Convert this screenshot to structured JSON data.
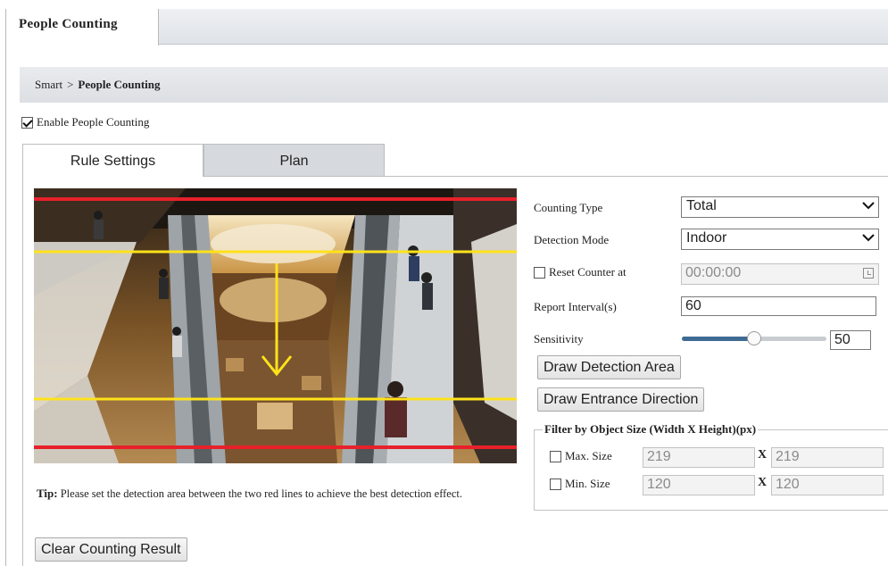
{
  "window_tab": {
    "title": "People Counting"
  },
  "breadcrumb": {
    "parent": "Smart",
    "separator": ">",
    "current": "People Counting"
  },
  "enable": {
    "label": "Enable People Counting",
    "checked": true
  },
  "tabs": [
    {
      "label": "Rule Settings",
      "active": true
    },
    {
      "label": "Plan",
      "active": false
    }
  ],
  "tip": {
    "prefix": "Tip:",
    "text": "Please set the detection area between the two red lines to achieve the best detection effect."
  },
  "buttons": {
    "clear": "Clear Counting Result",
    "draw_area": "Draw Detection Area",
    "draw_direction": "Draw Entrance Direction"
  },
  "settings": {
    "counting_type": {
      "label": "Counting Type",
      "value": "Total"
    },
    "detection_mode": {
      "label": "Detection Mode",
      "value": "Indoor"
    },
    "reset_counter": {
      "label": "Reset Counter at",
      "checked": false,
      "value": "00:00:00"
    },
    "report_interval": {
      "label": "Report Interval(s)",
      "value": "60"
    },
    "sensitivity": {
      "label": "Sensitivity",
      "value": "50",
      "fraction": 0.5
    }
  },
  "filter": {
    "legend": "Filter by Object Size (Width X Height)(px)",
    "separator": "X",
    "max": {
      "label": "Max. Size",
      "checked": false,
      "width": "219",
      "height": "219"
    },
    "min": {
      "label": "Min. Size",
      "checked": false,
      "width": "120",
      "height": "120"
    }
  },
  "colors": {
    "red_line": "#e8202a",
    "yellow_line": "#ffe21a",
    "slider_fill": "#3f6b93"
  },
  "icons": [
    "checkbox-icon",
    "chevron-down-icon",
    "clock-icon",
    "direction-arrow-icon"
  ]
}
